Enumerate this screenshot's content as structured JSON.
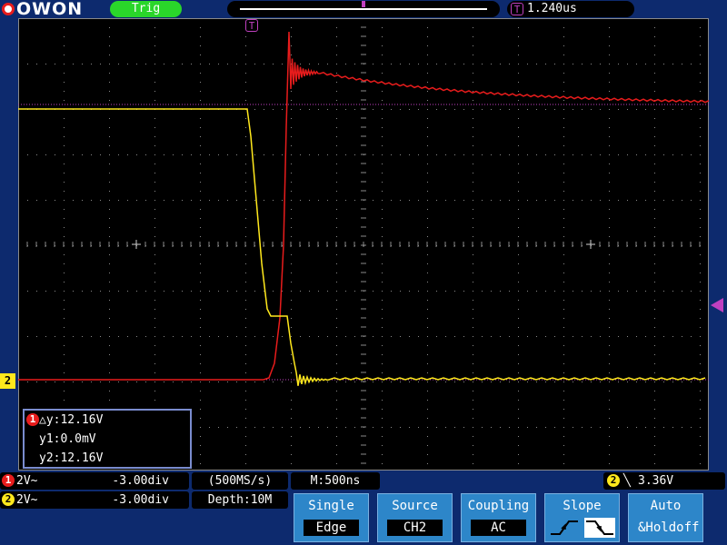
{
  "brand": {
    "logo_text": "OWON"
  },
  "status": {
    "trig_label": "Trig"
  },
  "time": {
    "offset_label": "1.240us",
    "trigger_badge": "T"
  },
  "channels": [
    {
      "id": "1",
      "badge": "1",
      "scale": "2V~",
      "offset": "-3.00div",
      "color": "#e81c1c"
    },
    {
      "id": "2",
      "badge": "2",
      "scale": "2V~",
      "offset": "-3.00div",
      "color": "#ffe81c"
    }
  ],
  "marker2_label": "2",
  "cursor": {
    "badge": "1",
    "delta_y": "△y:12.16V",
    "y1": "y1:0.0mV",
    "y2": "y2:12.16V"
  },
  "acquisition": {
    "sample_rate": "(500MS/s)",
    "depth": "Depth:10M",
    "timebase": "M:500ns"
  },
  "trigger_readout": {
    "channel_badge": "2",
    "edge_glyph": "╲",
    "level": "3.36V"
  },
  "softkeys": [
    {
      "top": "Single",
      "bottom": "Edge"
    },
    {
      "top": "Source",
      "bottom": "CH2"
    },
    {
      "top": "Coupling",
      "bottom": "AC"
    },
    {
      "top": "Slope",
      "bottom": ""
    },
    {
      "top": "Auto",
      "bottom": "&Holdoff"
    }
  ],
  "colors": {
    "ch1": "#e81c1c",
    "ch2": "#ffe81c",
    "trigger": "#c040c0",
    "background": "#0d2a6e",
    "screen": "#000000"
  }
}
